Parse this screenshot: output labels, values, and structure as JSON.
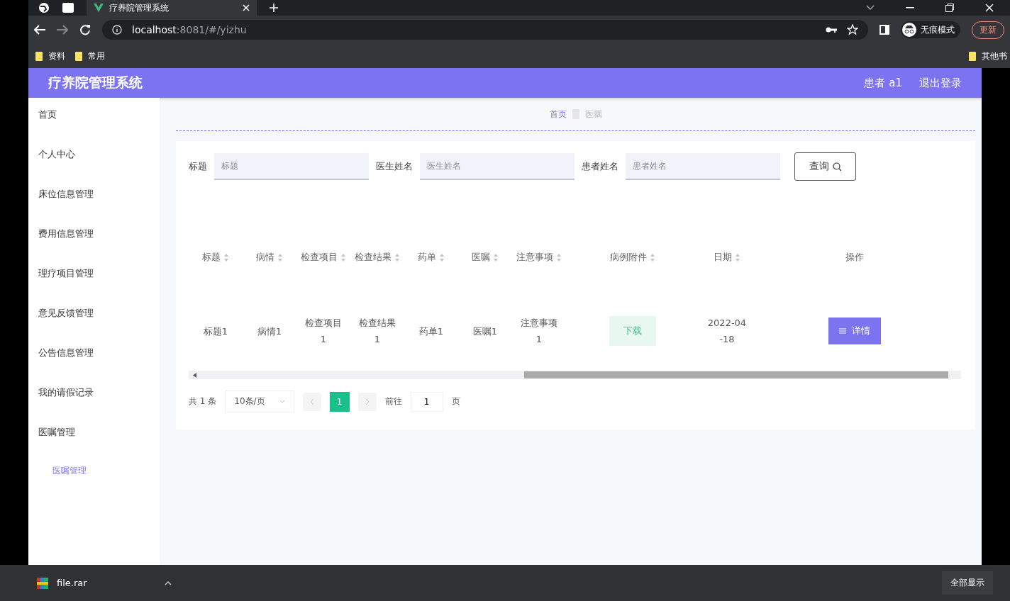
{
  "browser": {
    "tabs": [
      {
        "title": "疗养院管理系统",
        "selected": true
      }
    ],
    "url_host": "localhost",
    "url_path": ":8081/#/yizhu",
    "profile_label": "无痕模式",
    "update_button": "更新",
    "bookmarks": [
      "资料",
      "常用"
    ],
    "other_bookmarks": "其他书"
  },
  "header": {
    "title": "疗养院管理系统",
    "user": "患者 a1",
    "logout": "退出登录"
  },
  "sidebar": {
    "items": [
      {
        "label": "首页"
      },
      {
        "label": "个人中心"
      },
      {
        "label": "床位信息管理"
      },
      {
        "label": "费用信息管理"
      },
      {
        "label": "理疗项目管理"
      },
      {
        "label": "意见反馈管理"
      },
      {
        "label": "公告信息管理"
      },
      {
        "label": "我的请假记录"
      },
      {
        "label": "医嘱管理",
        "expanded": true,
        "children": [
          {
            "label": "医嘱管理",
            "selected": true
          }
        ]
      }
    ]
  },
  "breadcrumb": [
    {
      "label": "首页",
      "current": false
    },
    {
      "label": "医嘱",
      "current": true
    }
  ],
  "search": {
    "fields": [
      {
        "label": "标题",
        "placeholder": "标题"
      },
      {
        "label": "医生姓名",
        "placeholder": "医生姓名"
      },
      {
        "label": "患者姓名",
        "placeholder": "患者姓名"
      }
    ],
    "button": "查询"
  },
  "table": {
    "columns": [
      {
        "label": "标题",
        "sortable": true
      },
      {
        "label": "病情",
        "sortable": true
      },
      {
        "label": "检查项目",
        "sortable": true
      },
      {
        "label": "检查结果",
        "sortable": true
      },
      {
        "label": "药单",
        "sortable": true
      },
      {
        "label": "医嘱",
        "sortable": true
      },
      {
        "label": "注意事项",
        "sortable": true
      },
      {
        "label": "病例附件",
        "sortable": true
      },
      {
        "label": "日期",
        "sortable": true
      },
      {
        "label": "操作",
        "sortable": false
      }
    ],
    "rows": [
      {
        "cells": [
          "标题1",
          "病情1",
          "检查项目1",
          "检查结果1",
          "药单1",
          "医嘱1",
          "注意事项1"
        ],
        "attachment": "下载",
        "date": "2022-04-18",
        "action": "详情"
      }
    ]
  },
  "pagination": {
    "total": "共 1 条",
    "page_size": "10条/页",
    "pages": [
      {
        "label": "1",
        "selected": true
      }
    ],
    "goto": "前往",
    "goto_value": "1",
    "suffix": "页"
  },
  "download_bar": {
    "file": "file.rar",
    "show_all": "全部显示"
  }
}
